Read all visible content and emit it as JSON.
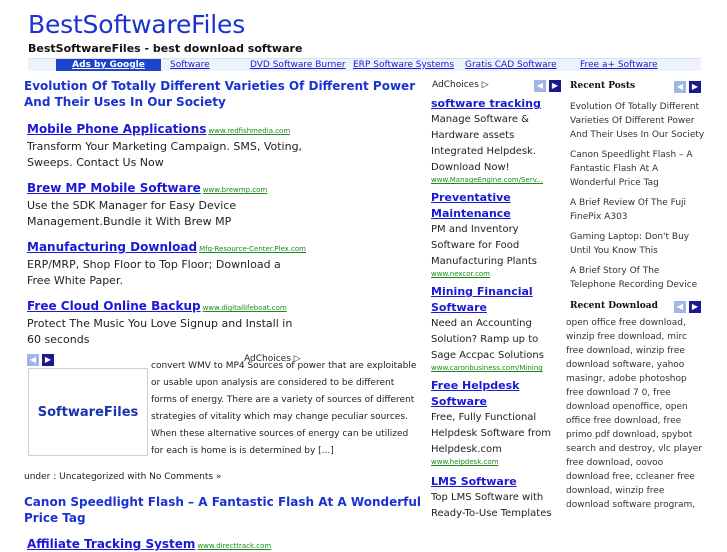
{
  "site": {
    "title": "BestSoftwareFiles",
    "tagline": "BestSoftwareFiles - best download software"
  },
  "nav": {
    "ads_label": "Ads by Google",
    "items": [
      "Software",
      "DVD Software Burner",
      "ERP Software Systems",
      "Gratis CAD Software",
      "Free a+ Software"
    ]
  },
  "main": {
    "post1_title": "Evolution Of Totally Different Varieties Of Different Power And Their Uses In Our Society",
    "ads": [
      {
        "title": "Mobile Phone Applications",
        "url": "www.redfishmedia.com",
        "desc": "Transform Your Marketing Campaign. SMS, Voting, Sweeps. Contact Us Now"
      },
      {
        "title": "Brew MP Mobile Software",
        "url": "www.brewmp.com",
        "desc": "Use the SDK Manager for Easy Device Management.Bundle it With Brew MP"
      },
      {
        "title": "Manufacturing Download",
        "url": "Mfg-Resource-Center.Plex.com",
        "desc": "ERP/MRP, Shop Floor to Top Floor; Download a Free White Paper."
      },
      {
        "title": "Free Cloud Online Backup",
        "url": "www.digitallifeboat.com",
        "desc": "Protect The Music You Love Signup and Install in 60 seconds"
      }
    ],
    "adchoices": "AdChoices ▷",
    "logo_text": "SoftwareFiles",
    "excerpt": "convert WMV to MP4 Sources of power that are exploitable or usable upon analysis are considered to be different forms of energy. There are a variety of sources of different strategies of vitality which may change peculiar sources. When these alternative sources of energy can be utilized for each is home is is determined by [...]",
    "meta_prefix": "under : ",
    "meta_category": "Uncategorized",
    "meta_with": " with ",
    "meta_comments": "No Comments »",
    "post2_title": "Canon Speedlight Flash – A Fantastic Flash At A Wonderful Price Tag",
    "ad5": {
      "title": "Affiliate Tracking System",
      "url": "www.directtrack.com"
    }
  },
  "mid": {
    "adchoices": "AdChoices ▷",
    "ads": [
      {
        "title": "software tracking",
        "desc": "Manage Software & Hardware assets Integrated Helpdesk. Download Now!",
        "url": "www.ManageEngine.com/Serv..."
      },
      {
        "title": "Preventative Maintenance",
        "desc": "PM and Inventory Software for Food Manufacturing Plants",
        "url": "www.nexcor.com"
      },
      {
        "title": "Mining Financial Software",
        "desc": "Need an Accounting Solution? Ramp up to Sage Accpac Solutions",
        "url": "www.caronbusiness.com/Mining"
      },
      {
        "title": "Free Helpdesk Software",
        "desc": "Free, Fully Functional Helpdesk Software from Helpdesk.com",
        "url": "www.helpdesk.com"
      },
      {
        "title": "LMS Software",
        "desc": "Top LMS Software with Ready-To-Use Templates",
        "url": ""
      }
    ]
  },
  "sidebar": {
    "recent_posts_heading": "Recent Posts",
    "recent_posts": [
      "Evolution Of Totally Different Varieties Of Different Power And Their Uses In Our Society",
      "Canon Speedlight Flash – A Fantastic Flash At A Wonderful Price Tag",
      "A Brief Review Of The Fuji FinePix A303",
      "Gaming Laptop: Don't Buy Until You Know This",
      "A Brief Story Of The Telephone Recording Device"
    ],
    "recent_download_heading": "Recent Download",
    "recent_download_text": "open office free download, winzip free download, mirc free download, winzip free download software, yahoo masingr, adobe photoshop free download 7 0, free download openoffice, open office free download, free primo pdf download, spybot search and destroy, vlc player free download, oovoo download free, ccleaner free download, winzip free download software program,"
  },
  "icons": {
    "prev": "chevron-left-icon",
    "next": "chevron-right-icon"
  },
  "colors": {
    "link": "#1a1ad6",
    "title": "#1a33d0",
    "url_green": "#1a8a1a",
    "ads_bg": "#1a44cc"
  }
}
